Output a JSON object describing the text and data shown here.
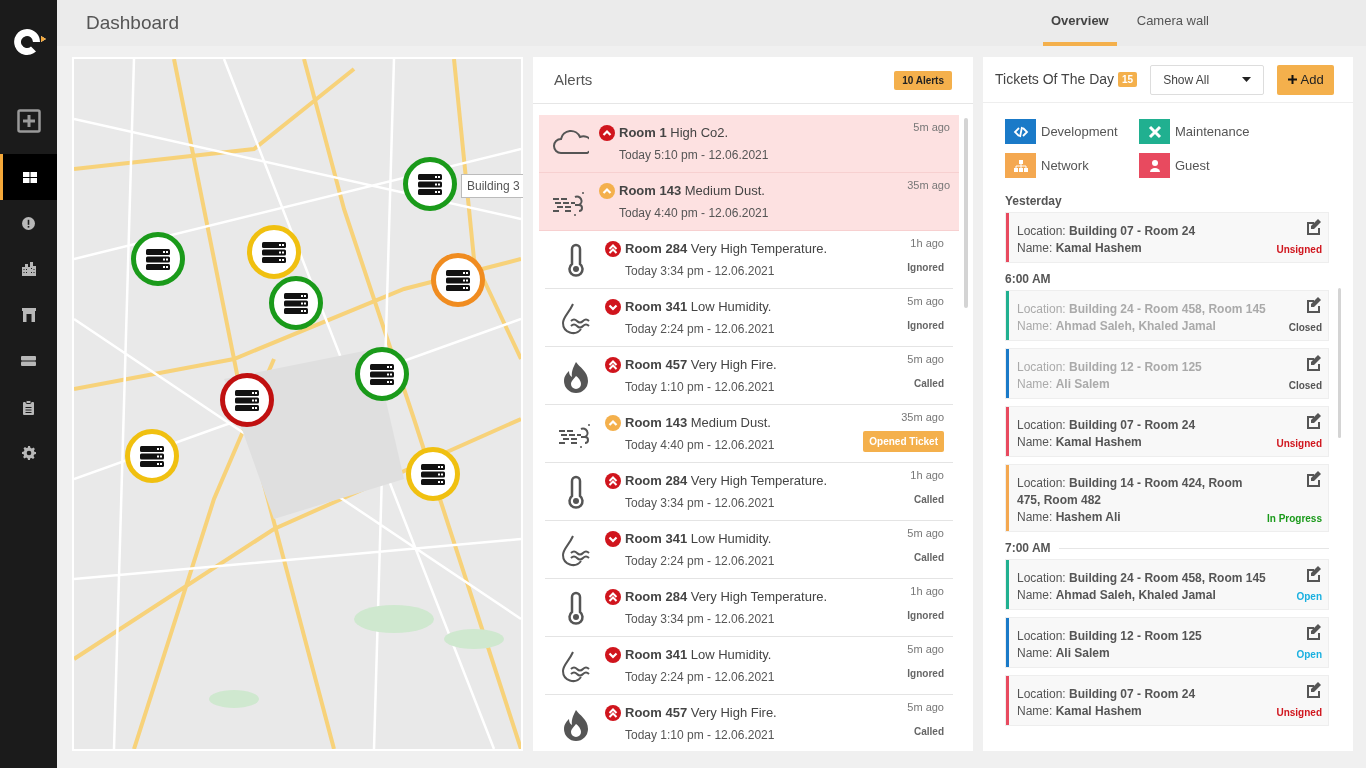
{
  "sidebar": {
    "items": [
      {
        "kind": "add",
        "selected": false
      },
      {
        "kind": "grid",
        "selected": true
      },
      {
        "kind": "alert",
        "selected": false
      },
      {
        "kind": "buildings",
        "selected": false
      },
      {
        "kind": "gate",
        "selected": false
      },
      {
        "kind": "server",
        "selected": false
      },
      {
        "kind": "clipboard",
        "selected": false
      },
      {
        "kind": "settings",
        "selected": false
      }
    ]
  },
  "header": {
    "title": "Dashboard",
    "tabs": [
      {
        "label": "Overview",
        "selected": true
      },
      {
        "label": "Camera wall",
        "selected": false
      }
    ]
  },
  "map": {
    "markers": [
      {
        "color": "#1a9a1a",
        "label": "Building 3"
      },
      {
        "color": "#1a9a1a"
      },
      {
        "color": "#f0c010"
      },
      {
        "color": "#1a9a1a"
      },
      {
        "color": "#f08c20"
      },
      {
        "color": "#1a9a1a"
      },
      {
        "color": "#c01010"
      },
      {
        "color": "#f0c010"
      },
      {
        "color": "#f0c010"
      }
    ]
  },
  "alerts": {
    "title": "Alerts",
    "badge": "10 Alerts",
    "items": [
      {
        "kind": "co2",
        "severity": {
          "kind": "up",
          "color": "#d0151d"
        },
        "highlighted": true,
        "title": "**Room 1** High Co2.",
        "time": "Today 5:10 pm - 12.06.2021",
        "ago": "5m ago"
      },
      {
        "kind": "dust",
        "severity": {
          "kind": "up",
          "color": "#f4b04c"
        },
        "highlighted": true,
        "title": "**Room 143** Medium Dust.",
        "time": "Today 4:40 pm - 12.06.2021",
        "ago": "35m ago"
      },
      {
        "kind": "temperature",
        "severity": {
          "kind": "double_up",
          "color": "#d0151d"
        },
        "highlighted": false,
        "title": "**Room 284** Very High Temperature.",
        "time": "Today 3:34 pm - 12.06.2021",
        "ago": "1h ago",
        "status": {
          "kind": "text",
          "text": "Ignored"
        }
      },
      {
        "kind": "humidity",
        "severity": {
          "kind": "down",
          "color": "#d0151d"
        },
        "highlighted": false,
        "title": "**Room 341** Low Humidity.",
        "time": "Today 2:24 pm - 12.06.2021",
        "ago": "5m ago",
        "status": {
          "kind": "text",
          "text": "Ignored"
        }
      },
      {
        "kind": "fire",
        "severity": {
          "kind": "double_up",
          "color": "#d0151d"
        },
        "highlighted": false,
        "title": "**Room 457** Very High Fire.",
        "time": "Today 1:10 pm - 12.06.2021",
        "ago": "5m ago",
        "status": {
          "kind": "text",
          "text": "Called"
        }
      },
      {
        "kind": "dust",
        "severity": {
          "kind": "up",
          "color": "#f4b04c"
        },
        "highlighted": false,
        "title": "**Room 143** Medium Dust.",
        "time": "Today 4:40 pm - 12.06.2021",
        "ago": "35m ago",
        "status": {
          "kind": "button",
          "text": "Opened Ticket"
        }
      },
      {
        "kind": "temperature",
        "severity": {
          "kind": "double_up",
          "color": "#d0151d"
        },
        "highlighted": false,
        "title": "**Room 284** Very High Temperature.",
        "time": "Today 3:34 pm - 12.06.2021",
        "ago": "1h ago",
        "status": {
          "kind": "text",
          "text": "Called"
        }
      },
      {
        "kind": "humidity",
        "severity": {
          "kind": "down",
          "color": "#d0151d"
        },
        "highlighted": false,
        "title": "**Room 341** Low Humidity.",
        "time": "Today 2:24 pm - 12.06.2021",
        "ago": "5m ago",
        "status": {
          "kind": "text",
          "text": "Called"
        }
      },
      {
        "kind": "temperature",
        "severity": {
          "kind": "double_up",
          "color": "#d0151d"
        },
        "highlighted": false,
        "title": "**Room 284** Very High Temperature.",
        "time": "Today 3:34 pm - 12.06.2021",
        "ago": "1h ago",
        "status": {
          "kind": "text",
          "text": "Ignored"
        }
      },
      {
        "kind": "humidity",
        "severity": {
          "kind": "down",
          "color": "#d0151d"
        },
        "highlighted": false,
        "title": "**Room 341** Low Humidity.",
        "time": "Today 2:24 pm - 12.06.2021",
        "ago": "5m ago",
        "status": {
          "kind": "text",
          "text": "Ignored"
        }
      },
      {
        "kind": "fire",
        "severity": {
          "kind": "double_up",
          "color": "#d0151d"
        },
        "highlighted": false,
        "title": "**Room 457** Very High Fire.",
        "time": "Today 1:10 pm - 12.06.2021",
        "ago": "5m ago",
        "status": {
          "kind": "text",
          "text": "Called"
        }
      }
    ]
  },
  "tickets": {
    "title": "Tickets Of The Day",
    "count": "15",
    "filter": "Show All",
    "add_button": "Add",
    "legend": [
      {
        "kind": "development",
        "label": "Development",
        "color": "#1a7ac8"
      },
      {
        "kind": "maintenance",
        "label": "Maintenance",
        "color": "#20b090"
      },
      {
        "kind": "network",
        "label": "Network",
        "color": "#f4a850"
      },
      {
        "kind": "guest",
        "label": "Guest",
        "color": "#e84a5f"
      }
    ],
    "groups": [
      {
        "heading": "Yesterday",
        "items": [
          {
            "color": "#e84a5f",
            "location": "Location: **Building 07 - Room 24**",
            "name": "Name: **Kamal Hashem**",
            "status": {
              "kind": "unsigned",
              "text": "Unsigned"
            },
            "disabled": false
          }
        ]
      },
      {
        "heading": "6:00 AM",
        "items": [
          {
            "color": "#20b090",
            "location": "Location: **Building 24 - Room 458, Room 145**",
            "name": "Name: **Ahmad Saleh, Khaled Jamal**",
            "status": {
              "kind": "closed",
              "text": "Closed"
            },
            "disabled": true
          },
          {
            "color": "#1a7ac8",
            "location": "Location: **Building 12 - Room 125**",
            "name": "Name: **Ali Salem**",
            "status": {
              "kind": "closed",
              "text": "Closed"
            },
            "disabled": true
          },
          {
            "color": "#e84a5f",
            "location": "Location: **Building 07 - Room 24**",
            "name": "Name: **Kamal Hashem**",
            "status": {
              "kind": "unsigned",
              "text": "Unsigned"
            },
            "disabled": false
          },
          {
            "color": "#f4a850",
            "location": "Location: **Building 14 - Room 424, Room 475, Room 482**",
            "name": "Name: **Hashem Ali**",
            "status": {
              "kind": "in_progress",
              "text": "In Progress"
            },
            "disabled": false
          }
        ]
      },
      {
        "heading": "7:00 AM",
        "items": [
          {
            "color": "#20b090",
            "location": "Location: **Building 24 - Room 458, Room 145**",
            "name": "Name: **Ahmad Saleh, Khaled Jamal**",
            "status": {
              "kind": "open",
              "text": "Open"
            },
            "disabled": false
          },
          {
            "color": "#1a7ac8",
            "location": "Location: **Building 12 - Room 125**",
            "name": "Name: **Ali Salem**",
            "status": {
              "kind": "open",
              "text": "Open"
            },
            "disabled": false
          },
          {
            "color": "#e84a5f",
            "location": "Location: **Building 07 - Room 24**",
            "name": "Name: **Kamal Hashem**",
            "status": {
              "kind": "unsigned",
              "text": "Unsigned"
            },
            "disabled": false
          }
        ]
      }
    ]
  }
}
